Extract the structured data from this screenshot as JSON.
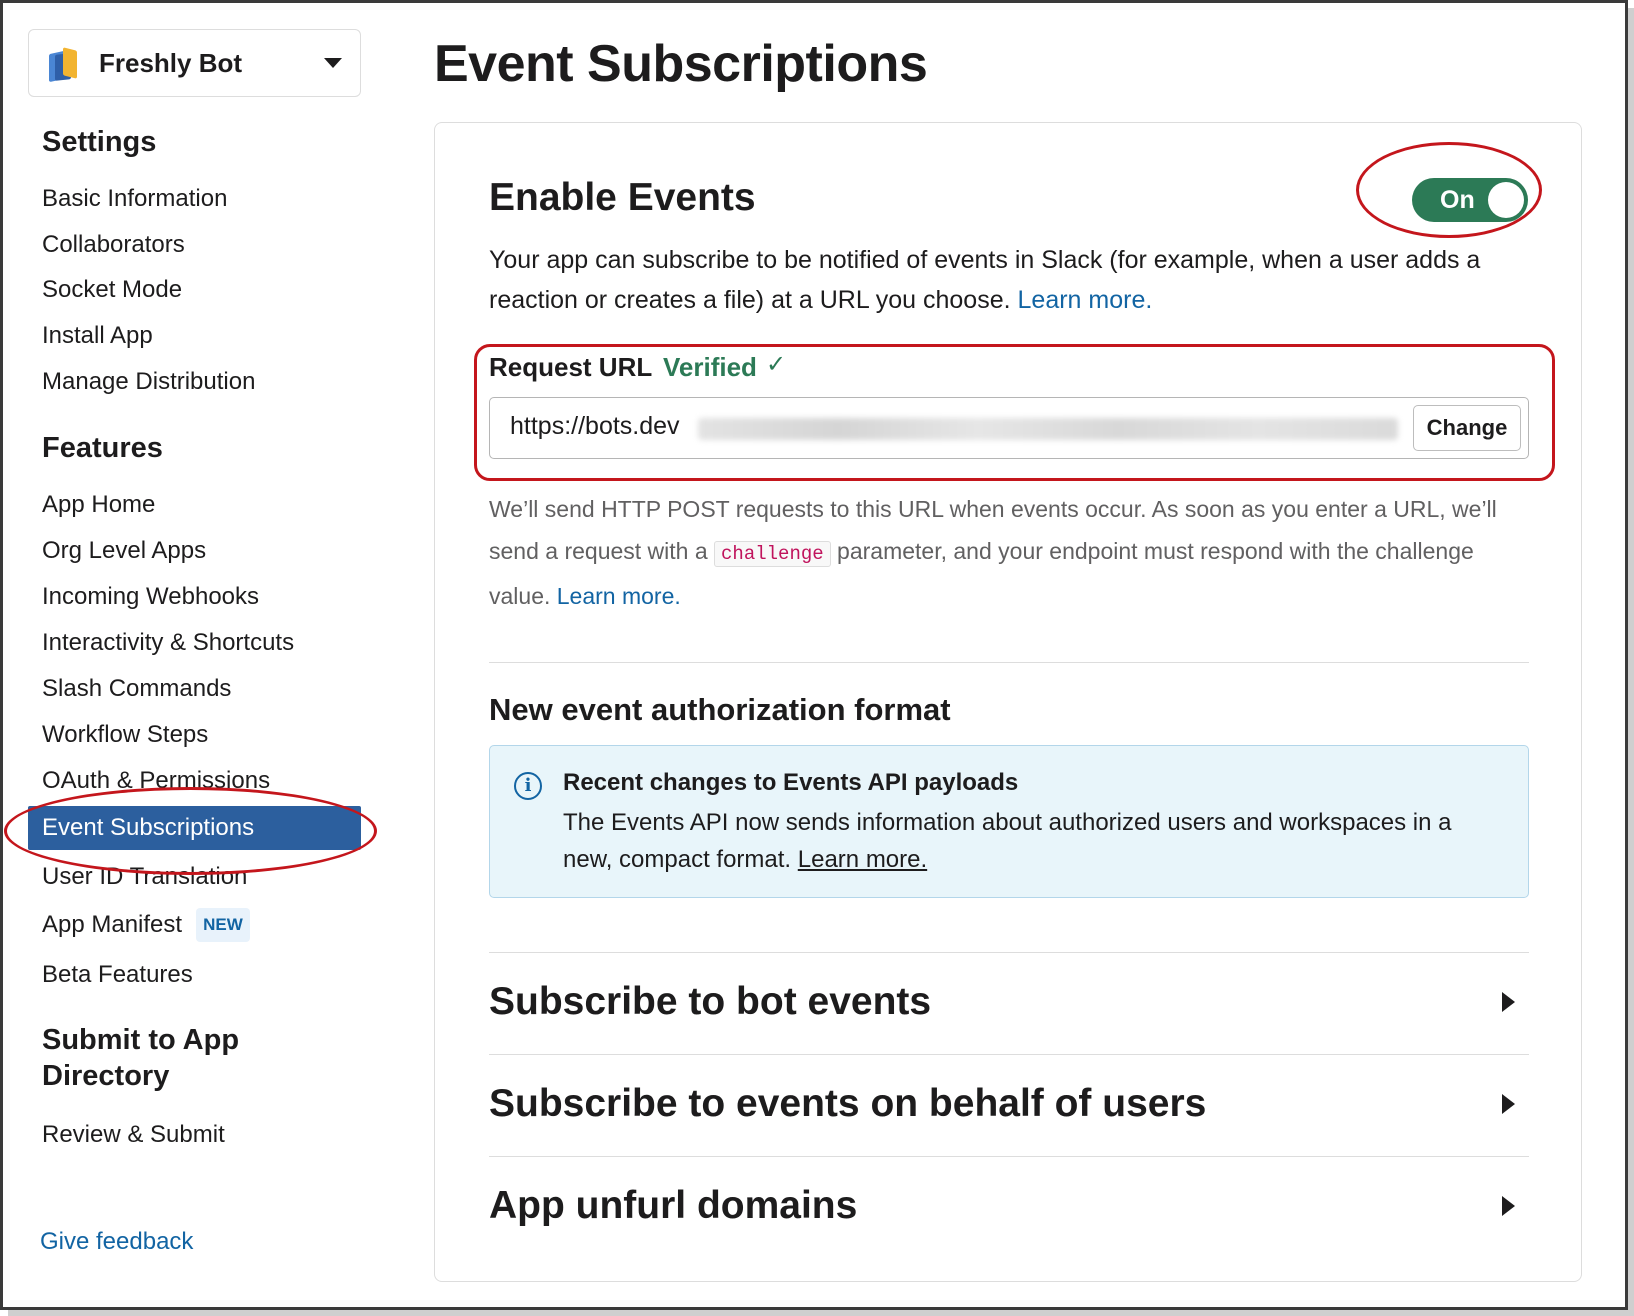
{
  "app": {
    "name": "Freshly Bot"
  },
  "sidebar": {
    "settings_heading": "Settings",
    "settings_items": [
      {
        "label": "Basic Information"
      },
      {
        "label": "Collaborators"
      },
      {
        "label": "Socket Mode"
      },
      {
        "label": "Install App"
      },
      {
        "label": "Manage Distribution"
      }
    ],
    "features_heading": "Features",
    "features_items": [
      {
        "label": "App Home"
      },
      {
        "label": "Org Level Apps"
      },
      {
        "label": "Incoming Webhooks"
      },
      {
        "label": "Interactivity & Shortcuts"
      },
      {
        "label": "Slash Commands"
      },
      {
        "label": "Workflow Steps"
      },
      {
        "label": "OAuth & Permissions"
      },
      {
        "label": "Event Subscriptions",
        "active": true
      },
      {
        "label": "User ID Translation"
      },
      {
        "label": "App Manifest",
        "badge": "NEW"
      },
      {
        "label": "Beta Features"
      }
    ],
    "submit_heading_line1": "Submit to App",
    "submit_heading_line2": "Directory",
    "submit_items": [
      {
        "label": "Review & Submit"
      }
    ],
    "feedback_label": "Give feedback"
  },
  "page": {
    "title": "Event Subscriptions",
    "enable_events": {
      "heading": "Enable Events",
      "toggle_label": "On",
      "toggle_state": true,
      "description": "Your app can subscribe to be notified of events in Slack (for example, when a user adds a reaction or creates a file) at a URL you choose.",
      "learn_more": "Learn more."
    },
    "request_url": {
      "label": "Request URL",
      "status": "Verified",
      "check_icon": "✓",
      "value_visible": "https://bots.dev",
      "change_button": "Change",
      "help_part1": "We’ll send HTTP POST requests to this URL when events occur. As soon as you enter a URL, we’ll send a request with a",
      "help_code": "challenge",
      "help_part2": "parameter, and your endpoint must respond with the challenge value.",
      "help_learn_more": "Learn more."
    },
    "auth_format": {
      "heading": "New event authorization format",
      "info_title": "Recent changes to Events API payloads",
      "info_body": "The Events API now sends information about authorized users and workspaces in a new, compact format.",
      "info_link": "Learn more."
    },
    "sections": [
      {
        "label": "Subscribe to bot events"
      },
      {
        "label": "Subscribe to events on behalf of users"
      },
      {
        "label": "App unfurl domains"
      }
    ]
  },
  "colors": {
    "accent_link": "#1264a3",
    "active_nav": "#2c5f9e",
    "toggle_on": "#2c7a56",
    "verified_green": "#2c7a56",
    "annotation_red": "#c4161c",
    "info_bg": "#e8f5fa"
  },
  "icons": {
    "app_icon": "books-icon",
    "dropdown": "chevron-down-icon",
    "info": "info-icon",
    "section_expand": "caret-right-icon"
  }
}
